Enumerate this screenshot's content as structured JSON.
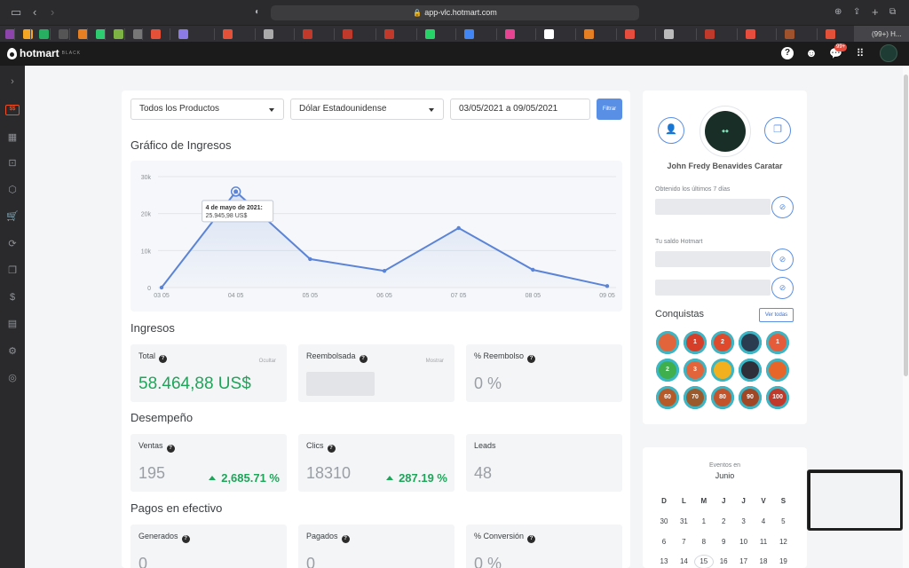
{
  "browser": {
    "url": "app-vlc.hotmart.com",
    "active_tab_label": "(99+) H..."
  },
  "header": {
    "brand": "hotmart",
    "brand_suffix": "BLACK",
    "notification_count": "99+"
  },
  "filters": {
    "product": "Todos los Productos",
    "currency": "Dólar Estadounidense",
    "date_range": "03/05/2021 a 09/05/2021",
    "button": "Filtrar"
  },
  "chart_section": {
    "title": "Gráfico de Ingresos"
  },
  "chart_data": {
    "type": "line",
    "title": "Gráfico de Ingresos",
    "x": [
      "03 05",
      "04 05",
      "05 05",
      "06 05",
      "07 05",
      "08 05",
      "09 05"
    ],
    "series": [
      {
        "values": [
          0,
          25945.98,
          7700,
          4500,
          16100,
          4800,
          400
        ]
      }
    ],
    "ylim": [
      0,
      30000
    ],
    "yticks": [
      "0",
      "10k",
      "20k",
      "30k"
    ],
    "tooltip": {
      "title": "4 de mayo de 2021:",
      "value": "25.945,98 US$"
    },
    "line_color": "#5b84d6"
  },
  "ingresos": {
    "title": "Ingresos",
    "total": {
      "label": "Total",
      "side": "Ocultar",
      "value": "58.464,88 US$"
    },
    "reembolsada": {
      "label": "Reembolsada",
      "side": "Mostrar"
    },
    "reembolso": {
      "label": "% Reembolso",
      "value": "0 %"
    }
  },
  "desempeno": {
    "title": "Desempeño",
    "ventas": {
      "label": "Ventas",
      "value": "195",
      "change": "2,685.71 %"
    },
    "clics": {
      "label": "Clics",
      "value": "18310",
      "change": "287.19 %"
    },
    "leads": {
      "label": "Leads",
      "value": "48"
    }
  },
  "pagos": {
    "title": "Pagos en efectivo",
    "generados": {
      "label": "Generados",
      "value": "0"
    },
    "pagados": {
      "label": "Pagados",
      "value": "0"
    },
    "conversion": {
      "label": "% Conversión",
      "value": "0 %"
    }
  },
  "profile": {
    "name": "John Fredy Benavides Caratar",
    "obtained_label": "Obtenido los últimos 7 días",
    "balance_label": "Tu saldo Hotmart",
    "conquistas_title": "Conquistas",
    "ver_todas": "Ver todas",
    "badges": [
      "",
      "1",
      "2",
      "",
      "1",
      "2",
      "3",
      "",
      "",
      "",
      "60",
      "70",
      "80",
      "90",
      "100"
    ]
  },
  "calendar": {
    "subtitle": "Eventos en",
    "month": "Junio",
    "weekdays": [
      "D",
      "L",
      "M",
      "J",
      "J",
      "V",
      "S"
    ],
    "rows": [
      [
        "30",
        "31",
        "1",
        "2",
        "3",
        "4",
        "5"
      ],
      [
        "6",
        "7",
        "8",
        "9",
        "10",
        "11",
        "12"
      ],
      [
        "13",
        "14",
        "15",
        "16",
        "17",
        "18",
        "19"
      ]
    ]
  }
}
